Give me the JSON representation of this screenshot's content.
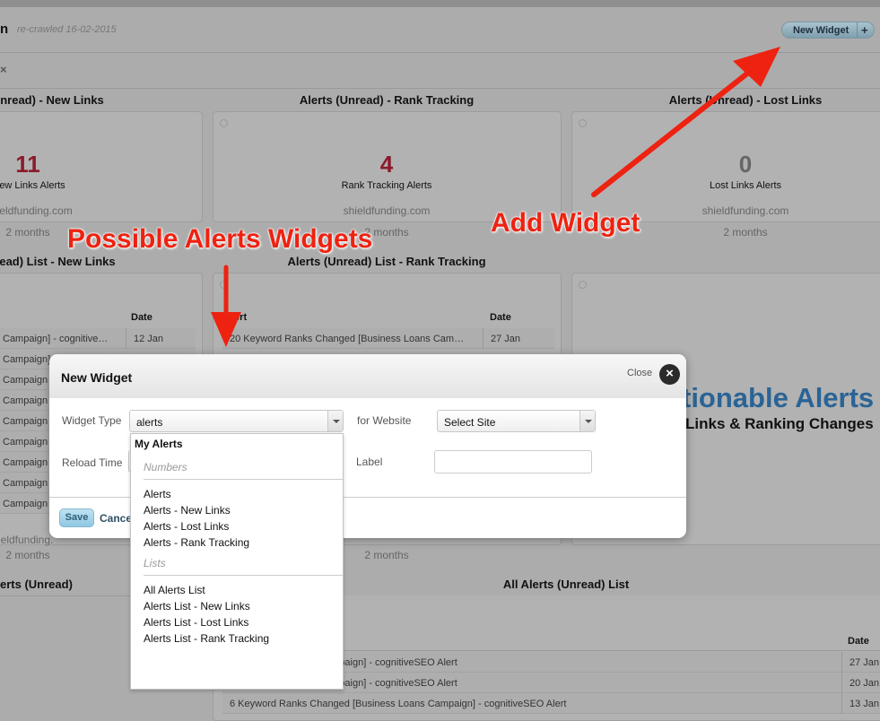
{
  "header": {
    "title_fragment": "n",
    "recrawled": "re-crawled 16-02-2015",
    "new_widget_label": "New Widget",
    "new_widget_plus": "+",
    "close_x": "×"
  },
  "row1": [
    {
      "title": "nread) - New Links",
      "value": "11",
      "value_color": "#8b1a2b",
      "label": "ew Links Alerts",
      "domain": "eldfunding.com",
      "age": "2 months"
    },
    {
      "title": "Alerts (Unread) - Rank Tracking",
      "value": "4",
      "value_color": "#8b1a2b",
      "label": "Rank Tracking Alerts",
      "domain": "shieldfunding.com",
      "age": "2 months"
    },
    {
      "title": "Alerts (Unread) - Lost Links",
      "value": "0",
      "value_color": "#666666",
      "label": "Lost Links Alerts",
      "domain": "shieldfunding.com",
      "age": "2 months"
    }
  ],
  "row2": {
    "col1": {
      "title": "ead) List - New Links",
      "date_header": "Date",
      "rows": [
        {
          "alert": "Campaign] - cognitive…",
          "date": "12 Jan"
        },
        {
          "alert": "Campaign]"
        },
        {
          "alert": "Campaign"
        },
        {
          "alert": "Campaign"
        },
        {
          "alert": "Campaign"
        },
        {
          "alert": "Campaign"
        },
        {
          "alert": "Campaign"
        },
        {
          "alert": "Campaign"
        },
        {
          "alert": "Campaign"
        }
      ],
      "domain": "eldfunding.",
      "age": "2 months"
    },
    "col2": {
      "title": "Alerts (Unread) List - Rank Tracking",
      "alert_header": "lert",
      "date_header": "Date",
      "rows": [
        {
          "alert": "20 Keyword Ranks Changed [Business Loans Cam…",
          "date": "27 Jan"
        }
      ],
      "age": "2 months"
    },
    "col3": {
      "headline": "tionable Alerts",
      "subline": "Links & Ranking Changes",
      "headline_color": "#2a6496"
    }
  },
  "row3": {
    "col1": {
      "title": "erts (Unread)"
    },
    "col2": {
      "title": "All Alerts (Unread) List",
      "date_header": "Date",
      "rows": [
        {
          "alert": "ed [Business Loans Campaign] - cognitiveSEO Alert",
          "date": "27 Jan"
        },
        {
          "alert": "ed [Business Loans Campaign] - cognitiveSEO Alert",
          "date": "20 Jan"
        },
        {
          "alert": "6 Keyword Ranks Changed [Business Loans Campaign] - cognitiveSEO Alert",
          "date": "13 Jan"
        }
      ]
    }
  },
  "modal": {
    "title": "New Widget",
    "close_label": "Close",
    "widget_type_label": "Widget Type",
    "widget_type_value": "alerts",
    "for_website_label": "for Website",
    "site_value": "Select Site",
    "reload_time_label": "Reload Time",
    "label_label": "Label",
    "label_value": "",
    "save_label": "Save",
    "cancel_label": "Cancel"
  },
  "dropdown": {
    "group": "My Alerts",
    "numbers_header": "Numbers",
    "numbers": [
      "Alerts",
      "Alerts - New Links",
      "Alerts - Lost Links",
      "Alerts - Rank Tracking"
    ],
    "lists_header": "Lists",
    "lists": [
      "All Alerts List",
      "Alerts List - New Links",
      "Alerts List - Lost Links",
      "Alerts List - Rank Tracking"
    ]
  },
  "annotations": {
    "possible": "Possible Alerts Widgets",
    "add": "Add Widget",
    "color": "#ee2211"
  }
}
